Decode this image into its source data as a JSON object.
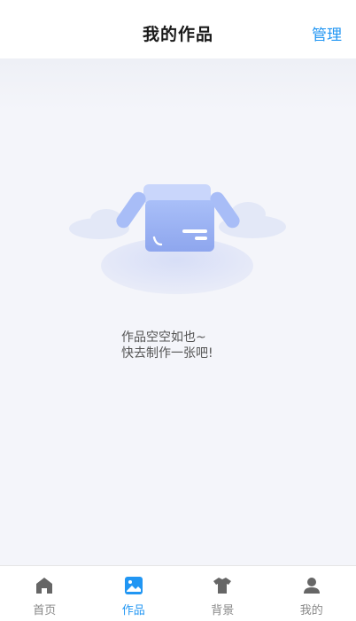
{
  "header": {
    "title": "我的作品",
    "manage_label": "管理"
  },
  "empty_state": {
    "line1": "作品空空如也~",
    "line2": "快去制作一张吧!"
  },
  "tabs": [
    {
      "label": "首页",
      "icon": "home-icon",
      "active": false
    },
    {
      "label": "作品",
      "icon": "picture-icon",
      "active": true
    },
    {
      "label": "背景",
      "icon": "tshirt-icon",
      "active": false
    },
    {
      "label": "我的",
      "icon": "user-icon",
      "active": false
    }
  ],
  "colors": {
    "accent": "#2196f3",
    "inactive": "#888888",
    "background": "#f4f5fa"
  }
}
